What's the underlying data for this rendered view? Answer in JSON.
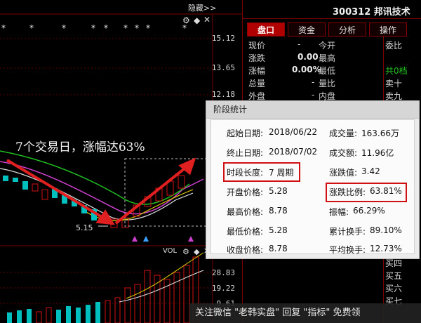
{
  "chart": {
    "hide_label": "隐藏>>",
    "axis_top": [
      "15.12",
      "13.65",
      "12.18"
    ],
    "axis_bottom": [
      "28.83",
      "19.22",
      "9.61"
    ],
    "low_label": "5.15",
    "vol_label": "VOL",
    "annotation": "7个交易日，涨幅达63%"
  },
  "panel": {
    "stock": "300312 邦讯技术",
    "tabs": [
      "盘口",
      "资金",
      "分析",
      "操作"
    ],
    "rows": [
      {
        "l1": "现价",
        "v1": "-",
        "l2": "今开",
        "v2": ""
      },
      {
        "l1": "涨跌",
        "v1": "0.00",
        "l2": "最高",
        "v2": ""
      },
      {
        "l1": "涨幅",
        "v1": "0.00%",
        "l2": "最低",
        "v2": ""
      },
      {
        "l1": "总量",
        "v1": "-",
        "l2": "量比",
        "v2": ""
      },
      {
        "l1": "外盘",
        "v1": "-",
        "l2": "内盘",
        "v2": ""
      }
    ],
    "side_top": [
      "委比",
      "共0档",
      "卖十",
      "卖九"
    ],
    "side_bottom": [
      "买四",
      "买五",
      "买六",
      "买七"
    ]
  },
  "dialog": {
    "title": "阶段统计",
    "left": [
      {
        "label": "起始日期:",
        "value": "2018/06/22"
      },
      {
        "label": "终止日期:",
        "value": "2018/07/02"
      },
      {
        "label": "时段长度:",
        "value": "7 周期"
      },
      {
        "label": "开盘价格:",
        "value": "5.28"
      },
      {
        "label": "最高价格:",
        "value": "8.78"
      },
      {
        "label": "最低价格:",
        "value": "5.28"
      },
      {
        "label": "收盘价格:",
        "value": "8.78"
      }
    ],
    "right": [
      {
        "label": "成交量:",
        "value": "163.66万"
      },
      {
        "label": "成交额:",
        "value": "11.96亿"
      },
      {
        "label": "涨跌值:",
        "value": "3.42"
      },
      {
        "label": "涨跌比例:",
        "value": "63.81%"
      },
      {
        "label": "振幅:",
        "value": "66.29%"
      },
      {
        "label": "累计换手:",
        "value": "89.10%"
      },
      {
        "label": "平均换手:",
        "value": "12.73%"
      }
    ]
  },
  "watermark": "关注微信 \"老韩实盘\" 回复 \"指标\" 免费领",
  "colors": {
    "up": "#d01010",
    "down": "#00bfbf",
    "accent": "#b00000"
  }
}
